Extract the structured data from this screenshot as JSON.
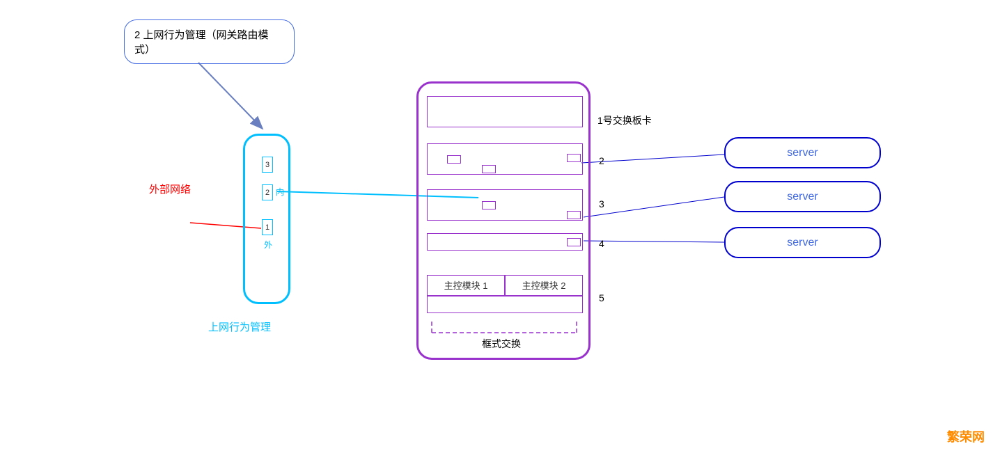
{
  "callout": {
    "text": "2 上网行为管理（网关路由模式）"
  },
  "external_network_label": "外部网络",
  "gateway": {
    "port3_num": "3",
    "port2_num": "2",
    "port2_label": "内",
    "port1_num": "1",
    "port1_label": "外",
    "caption": "上网行为管理"
  },
  "chassis": {
    "slot1_label": "1号交换板卡",
    "slot2_label": "2",
    "slot3_label": "3",
    "slot4_label": "4",
    "slot5_label": "5",
    "module1": "主控模块 1",
    "module2": "主控模块 2",
    "caption": "框式交换"
  },
  "servers": {
    "s1": "server",
    "s2": "server",
    "s3": "server"
  },
  "watermark": "繁荣网"
}
